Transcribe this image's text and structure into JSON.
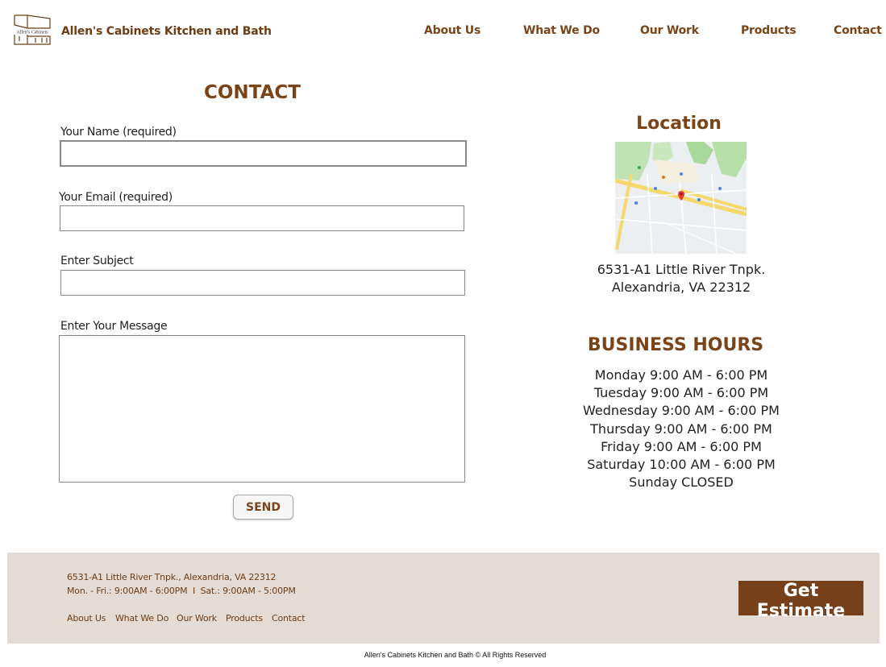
{
  "header": {
    "brand": "Allen's Cabinets Kitchen and Bath",
    "logo_text": "Allen's Cabinets",
    "nav": [
      "About Us",
      "What We Do",
      "Our Work",
      "Products",
      "Contact"
    ]
  },
  "contact": {
    "title": "CONTACT",
    "name_label": "Your Name (required)",
    "name_value": "",
    "email_label": "Your Email (required)",
    "email_value": "",
    "subject_label": "Enter Subject",
    "subject_value": "",
    "message_label": "Enter Your Message",
    "message_value": "",
    "send_label": "SEND"
  },
  "location": {
    "title": "Location",
    "address_line1": "6531-A1 Little River Tnpk.",
    "address_line2": "Alexandria, VA 22312"
  },
  "hours": {
    "title": "BUSINESS HOURS",
    "rows": [
      "Monday  9:00 AM - 6:00 PM",
      "Tuesday  9:00 AM - 6:00 PM",
      "Wednesday  9:00 AM - 6:00 PM",
      "Thursday  9:00 AM - 6:00 PM",
      "Friday  9:00 AM - 6:00 PM",
      "Saturday  10:00 AM - 6:00 PM",
      "Sunday  CLOSED"
    ]
  },
  "footer": {
    "address": "6531-A1 Little River Tnpk., Alexandria, VA 22312",
    "hours": "Mon. - Fri.: 9:00AM - 6:00PM  I  Sat.: 9:00AM - 5:00PM",
    "links": [
      "About Us",
      "What We Do",
      "Our Work",
      "Products",
      "Contact"
    ],
    "estimate_label": "Get Estimate",
    "copyright": "Allen's Cabinets Kitchen and Bath © All Rights Reserved"
  },
  "colors": {
    "brand": "#7a4418",
    "footer_bg": "#e5dbd5",
    "button_bg": "#76411a"
  },
  "icons": [
    "logo-icon",
    "map-image",
    "map-pin-icon"
  ]
}
